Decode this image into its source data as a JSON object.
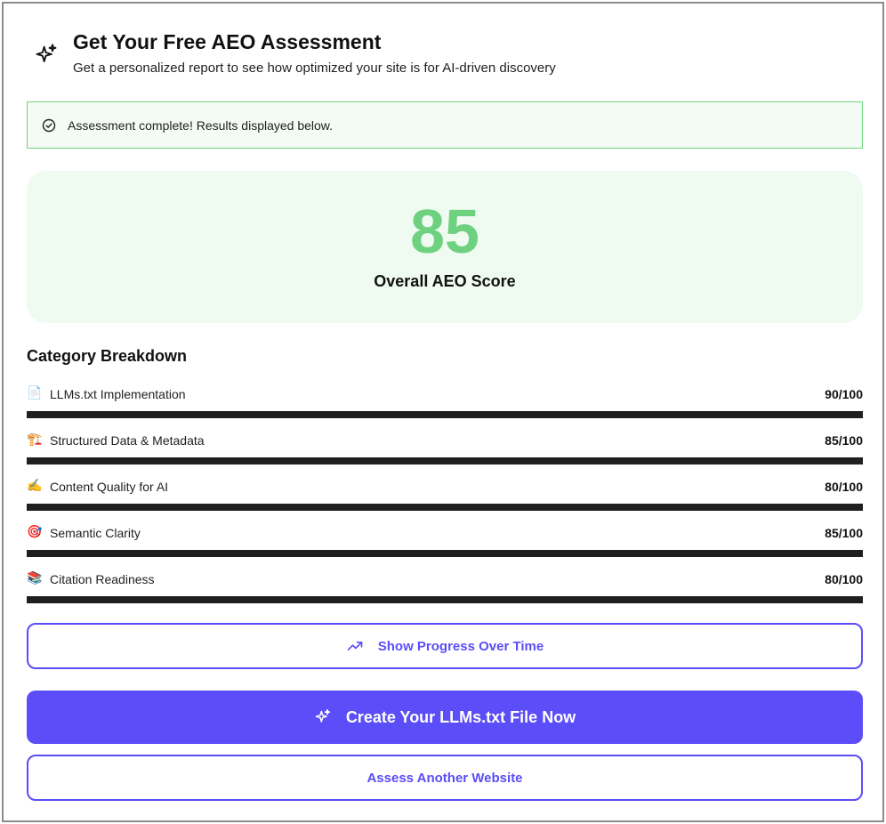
{
  "header": {
    "icon": "sparkles-icon",
    "title": "Get Your Free AEO Assessment",
    "subtitle": "Get a personalized report to see how optimized your site is for AI-driven discovery"
  },
  "alert": {
    "icon": "check-circle-icon",
    "text": "Assessment complete! Results displayed below.",
    "border_color": "#6fd27c"
  },
  "score": {
    "value": "85",
    "label": "Overall AEO Score",
    "color": "#6ed17f"
  },
  "categories": {
    "heading": "Category Breakdown",
    "items": [
      {
        "emoji": "📄",
        "name": "LLMs.txt Implementation",
        "score": "90/100",
        "value": 90
      },
      {
        "emoji": "🏗️",
        "name": "Structured Data & Metadata",
        "score": "85/100",
        "value": 85
      },
      {
        "emoji": "✍️",
        "name": "Content Quality for AI",
        "score": "80/100",
        "value": 80
      },
      {
        "emoji": "🎯",
        "name": "Semantic Clarity",
        "score": "85/100",
        "value": 85
      },
      {
        "emoji": "📚",
        "name": "Citation Readiness",
        "score": "80/100",
        "value": 80
      }
    ]
  },
  "buttons": {
    "progress_label": "Show Progress Over Time",
    "progress_icon": "trending-up-icon",
    "create_label": "Create Your LLMs.txt File Now",
    "create_icon": "sparkles-icon",
    "assess_label": "Assess Another Website"
  },
  "colors": {
    "accent": "#5b4df7",
    "bar": "#1f1f1f"
  }
}
